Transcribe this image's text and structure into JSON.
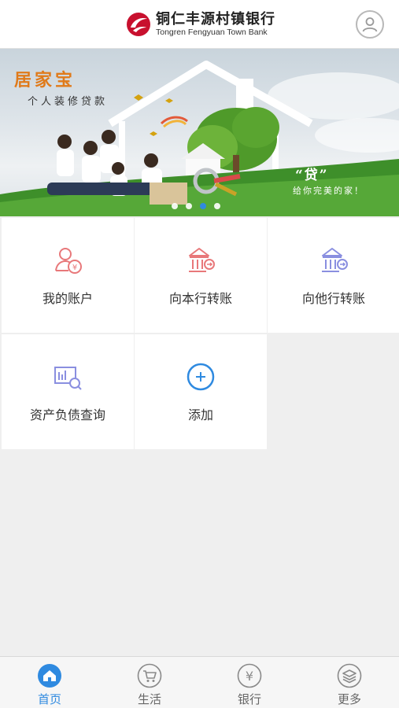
{
  "header": {
    "bank_name_cn": "铜仁丰源村镇银行",
    "bank_name_en": "Tongren Fengyuan Town Bank",
    "logo_icon": "bank-logo-icon",
    "profile_icon": "user-icon"
  },
  "banner": {
    "title": "居家宝",
    "subtitle": "个人装修贷款",
    "slogan": "“贷”",
    "slogan_sub": "给你完美的家！",
    "slides_total": 4,
    "active_slide": 3
  },
  "services": [
    {
      "label": "我的账户",
      "icon": "account-icon"
    },
    {
      "label": "向本行转账",
      "icon": "bank-transfer-icon"
    },
    {
      "label": "向他行转账",
      "icon": "other-bank-transfer-icon"
    },
    {
      "label": "资产负债查询",
      "icon": "report-search-icon"
    },
    {
      "label": "添加",
      "icon": "add-icon"
    }
  ],
  "tabbar": {
    "items": [
      {
        "label": "首页",
        "icon": "home-icon",
        "active": true
      },
      {
        "label": "生活",
        "icon": "cart-icon",
        "active": false
      },
      {
        "label": "银行",
        "icon": "yuan-icon",
        "active": false
      },
      {
        "label": "更多",
        "icon": "layers-icon",
        "active": false
      }
    ]
  },
  "colors": {
    "accent": "#2f8ae0",
    "brand_red": "#c8102e",
    "icon_red": "#e8787a",
    "icon_purple": "#8a8fe0"
  }
}
